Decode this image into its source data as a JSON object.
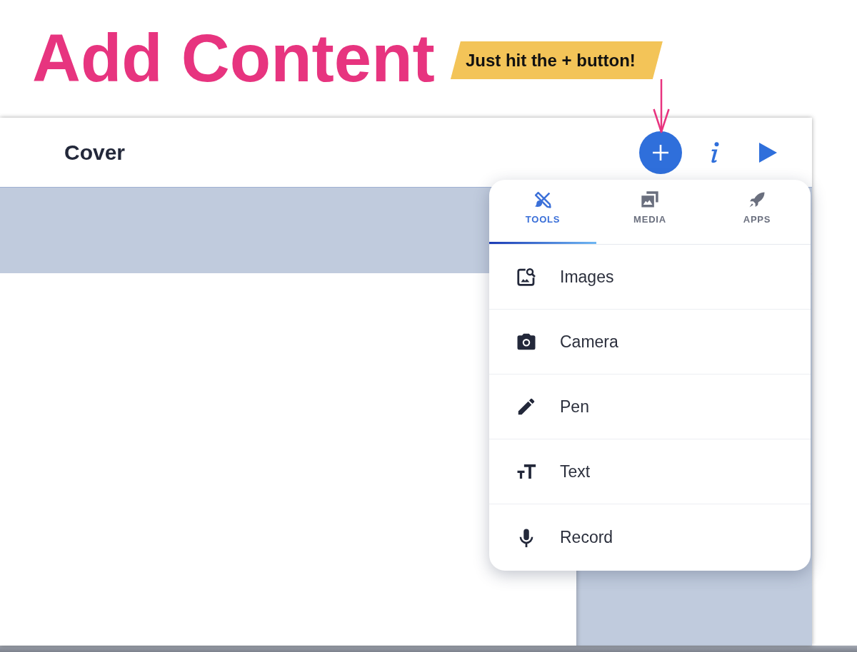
{
  "headline": "Add Content",
  "callout": "Just hit the + button!",
  "app": {
    "title": "Cover",
    "menu": {
      "tabs": [
        {
          "label": "TOOLS",
          "kind": "tools",
          "selected": true
        },
        {
          "label": "MEDIA",
          "kind": "media",
          "selected": false
        },
        {
          "label": "APPS",
          "kind": "apps",
          "selected": false
        }
      ],
      "items": [
        {
          "label": "Images",
          "kind": "images"
        },
        {
          "label": "Camera",
          "kind": "camera"
        },
        {
          "label": "Pen",
          "kind": "pen"
        },
        {
          "label": "Text",
          "kind": "text"
        },
        {
          "label": "Record",
          "kind": "record"
        }
      ]
    }
  }
}
